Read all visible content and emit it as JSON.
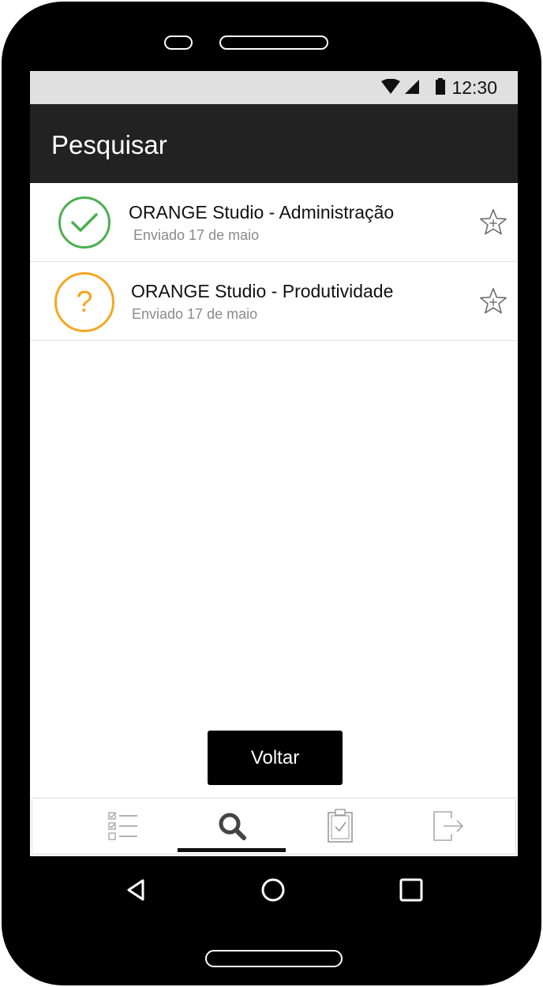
{
  "status_bar": {
    "time": "12:30",
    "icons": [
      "wifi-icon",
      "cellular-signal-icon",
      "battery-icon"
    ]
  },
  "app_bar": {
    "title": "Pesquisar"
  },
  "results": [
    {
      "title": "ORANGE Studio - Administração",
      "subtitle": "Enviado 17 de maio",
      "status": "completed",
      "status_icon": "check-icon",
      "status_color": "#4caf50",
      "favorite_icon": "star-outline-icon"
    },
    {
      "title": "ORANGE Studio - Produtividade",
      "subtitle": "Enviado 17 de maio",
      "status": "pending",
      "status_icon": "question-mark-icon",
      "status_color": "#f5a623",
      "status_glyph": "?",
      "favorite_icon": "star-outline-icon"
    }
  ],
  "back_button": {
    "label": "Voltar"
  },
  "bottom_nav": {
    "items": [
      {
        "icon": "checklist-icon"
      },
      {
        "icon": "search-icon",
        "active": true
      },
      {
        "icon": "clipboard-check-icon"
      },
      {
        "icon": "logout-icon"
      }
    ]
  },
  "system_nav": {
    "icons": [
      "back-triangle-icon",
      "home-circle-icon",
      "recents-square-icon"
    ]
  }
}
